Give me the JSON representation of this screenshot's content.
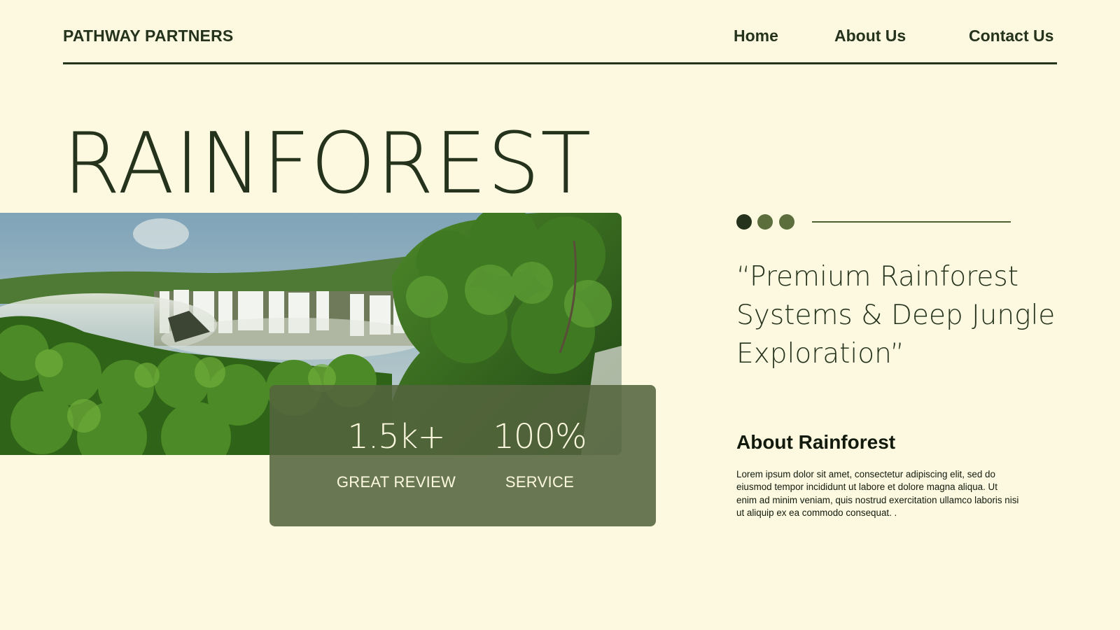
{
  "header": {
    "brand": "PATHWAY PARTNERS",
    "nav": {
      "home": "Home",
      "about": "About Us",
      "contact": "Contact Us"
    }
  },
  "hero": {
    "title": "RAINFOREST",
    "image": "rainforest waterfall photo"
  },
  "stats": [
    {
      "value": "1.5k+",
      "label": "GREAT REVIEW"
    },
    {
      "value": "100%",
      "label": "SERVICE"
    }
  ],
  "quote": "“Premium Rainforest Systems & Deep Jungle Exploration”",
  "about": {
    "title": "About Rainforest",
    "body": "Lorem ipsum dolor sit amet, consectetur adipiscing elit, sed do eiusmod tempor incididunt ut labore et dolore magna aliqua. Ut enim ad minim veniam, quis nostrud exercitation ullamco laboris nisi ut aliquip ex ea commodo consequat. ."
  },
  "colors": {
    "background": "#fdf9e1",
    "primary": "#25331c",
    "accent": "#5c6e3c",
    "card": "#54643e"
  }
}
